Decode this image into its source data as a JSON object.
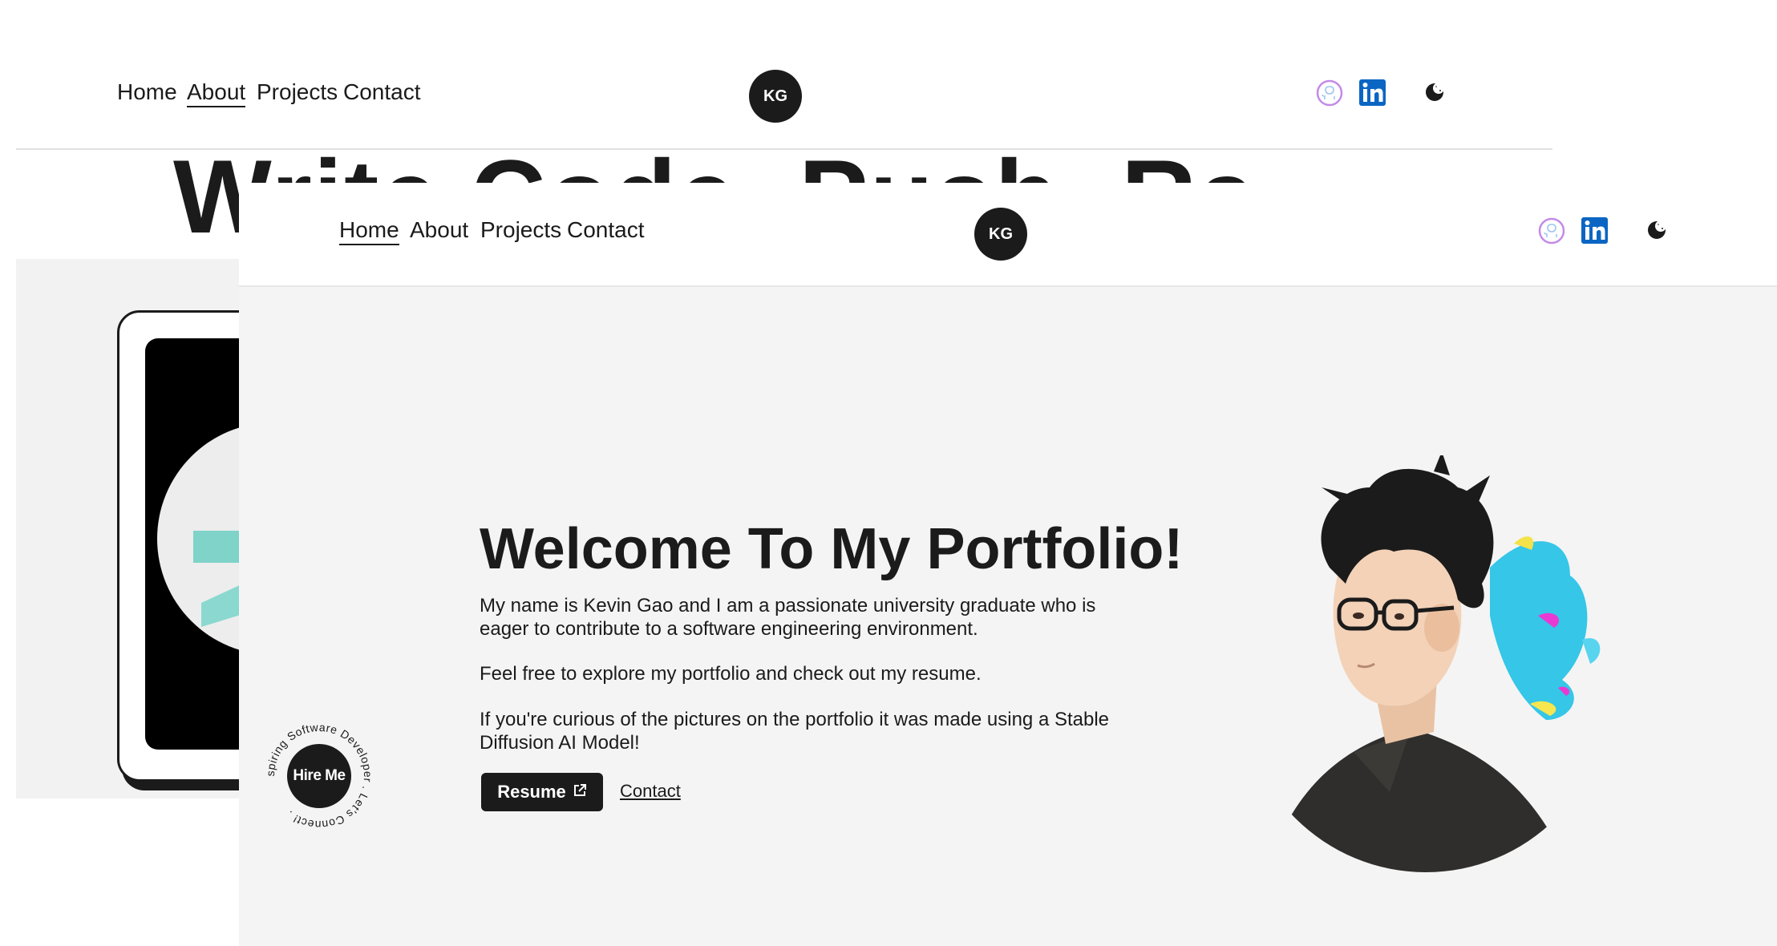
{
  "nav": {
    "links": [
      "Home",
      "About",
      "Projects",
      "Contact"
    ],
    "logo": "KG"
  },
  "background_page": {
    "active_link": "About",
    "heading_fragment": "Write Code. Push. Ra"
  },
  "foreground_page": {
    "active_link": "Home",
    "hero": {
      "title": "Welcome To My Portfolio!",
      "para1": "My name is Kevin Gao and I am a passionate university graduate who is eager to contribute to a software engineering environment.",
      "para2": "Feel free to explore my portfolio and check out my resume.",
      "para3": "If you're curious of the pictures on the portfolio it was made using a Stable Diffusion AI Model!",
      "resume_label": "Resume",
      "contact_label": "Contact"
    },
    "hire_me": {
      "label": "Hire Me",
      "ring_text": "Aspiring Software Developer . Let's Connect! ."
    }
  },
  "icons": [
    "github-icon",
    "linkedin-icon",
    "moon-icon",
    "external-link-icon"
  ],
  "colors": {
    "dark": "#1b1b1b",
    "background": "#f4f4f4",
    "linkedin": "#0a66c2"
  }
}
